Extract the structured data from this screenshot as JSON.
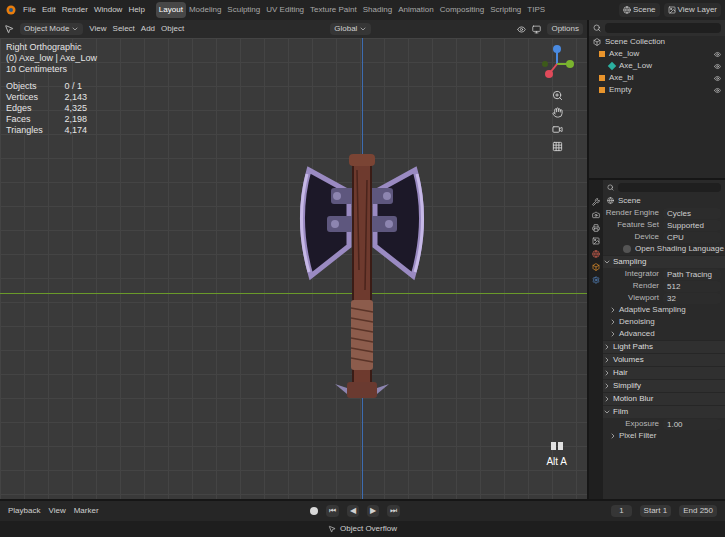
{
  "menu": [
    "File",
    "Edit",
    "Render",
    "Window",
    "Help"
  ],
  "workspaces": [
    {
      "label": "Layout",
      "selected": true
    },
    {
      "label": "Modeling",
      "selected": false
    },
    {
      "label": "Sculpting",
      "selected": false
    },
    {
      "label": "UV Editing",
      "selected": false
    },
    {
      "label": "Texture Paint",
      "selected": false
    },
    {
      "label": "Shading",
      "selected": false
    },
    {
      "label": "Animation",
      "selected": false
    },
    {
      "label": "Compositing",
      "selected": false
    },
    {
      "label": "Scripting",
      "selected": false
    },
    {
      "label": "TIPS",
      "selected": false
    }
  ],
  "scene_selector": "Scene",
  "view_layer": "View Layer",
  "viewport_header": {
    "mode": "Object Mode",
    "menus": [
      "View",
      "Select",
      "Add",
      "Object"
    ],
    "transform": "Global",
    "options": "Options"
  },
  "viewport": {
    "view_name": "Right Orthographic",
    "object_label": "(0) Axe_low | Axe_Low",
    "scale": "10 Centimeters",
    "stats": [
      {
        "label": "Objects",
        "value": "0 / 1"
      },
      {
        "label": "Vertices",
        "value": "2,143"
      },
      {
        "label": "Edges",
        "value": "4,325"
      },
      {
        "label": "Faces",
        "value": "2,198"
      },
      {
        "label": "Triangles",
        "value": "4,174"
      }
    ],
    "key_hint": "Alt A"
  },
  "outliner": {
    "items": [
      {
        "label": "Scene Collection",
        "kind": "root"
      },
      {
        "label": "Axe_low",
        "kind": "object"
      },
      {
        "label": "Axe_Low",
        "kind": "mesh"
      },
      {
        "label": "Axe_bl",
        "kind": "object"
      },
      {
        "label": "Empty",
        "kind": "object"
      }
    ]
  },
  "properties": {
    "title": "Scene",
    "rows": [
      {
        "kind": "field",
        "label": "Render Engine",
        "value": "Cycles"
      },
      {
        "kind": "field",
        "label": "Feature Set",
        "value": "Supported"
      },
      {
        "kind": "field",
        "label": "Device",
        "value": "CPU"
      },
      {
        "kind": "check",
        "label": "Open Shading Language",
        "checked": false
      },
      {
        "kind": "section",
        "label": "Sampling",
        "expanded": true
      },
      {
        "kind": "field",
        "label": "Integrator",
        "value": "Path Tracing"
      },
      {
        "kind": "field",
        "label": "Render",
        "value": "512"
      },
      {
        "kind": "field",
        "label": "Viewport",
        "value": "32"
      },
      {
        "kind": "subsection",
        "label": "Adaptive Sampling",
        "expanded": false
      },
      {
        "kind": "subsection",
        "label": "Denoising",
        "expanded": false
      },
      {
        "kind": "subsection",
        "label": "Advanced",
        "expanded": false
      },
      {
        "kind": "section",
        "label": "Light Paths",
        "expanded": false
      },
      {
        "kind": "section",
        "label": "Volumes",
        "expanded": false
      },
      {
        "kind": "section",
        "label": "Hair",
        "expanded": false
      },
      {
        "kind": "section",
        "label": "Simplify",
        "expanded": false
      },
      {
        "kind": "section",
        "label": "Motion Blur",
        "expanded": false
      },
      {
        "kind": "section",
        "label": "Film",
        "expanded": true
      },
      {
        "kind": "field",
        "label": "Exposure",
        "value": "1.00"
      },
      {
        "kind": "subsection",
        "label": "Pixel Filter",
        "expanded": false
      }
    ]
  },
  "timeline": {
    "menus": [
      "Playback",
      "View",
      "Marker"
    ],
    "transport": [
      "⏮",
      "◀",
      "▶",
      "⏭"
    ],
    "current_frame": "1",
    "start_label": "Start",
    "start": "1",
    "end_label": "End",
    "end": "250"
  },
  "status_bar": {
    "message": "Object Overflow"
  }
}
